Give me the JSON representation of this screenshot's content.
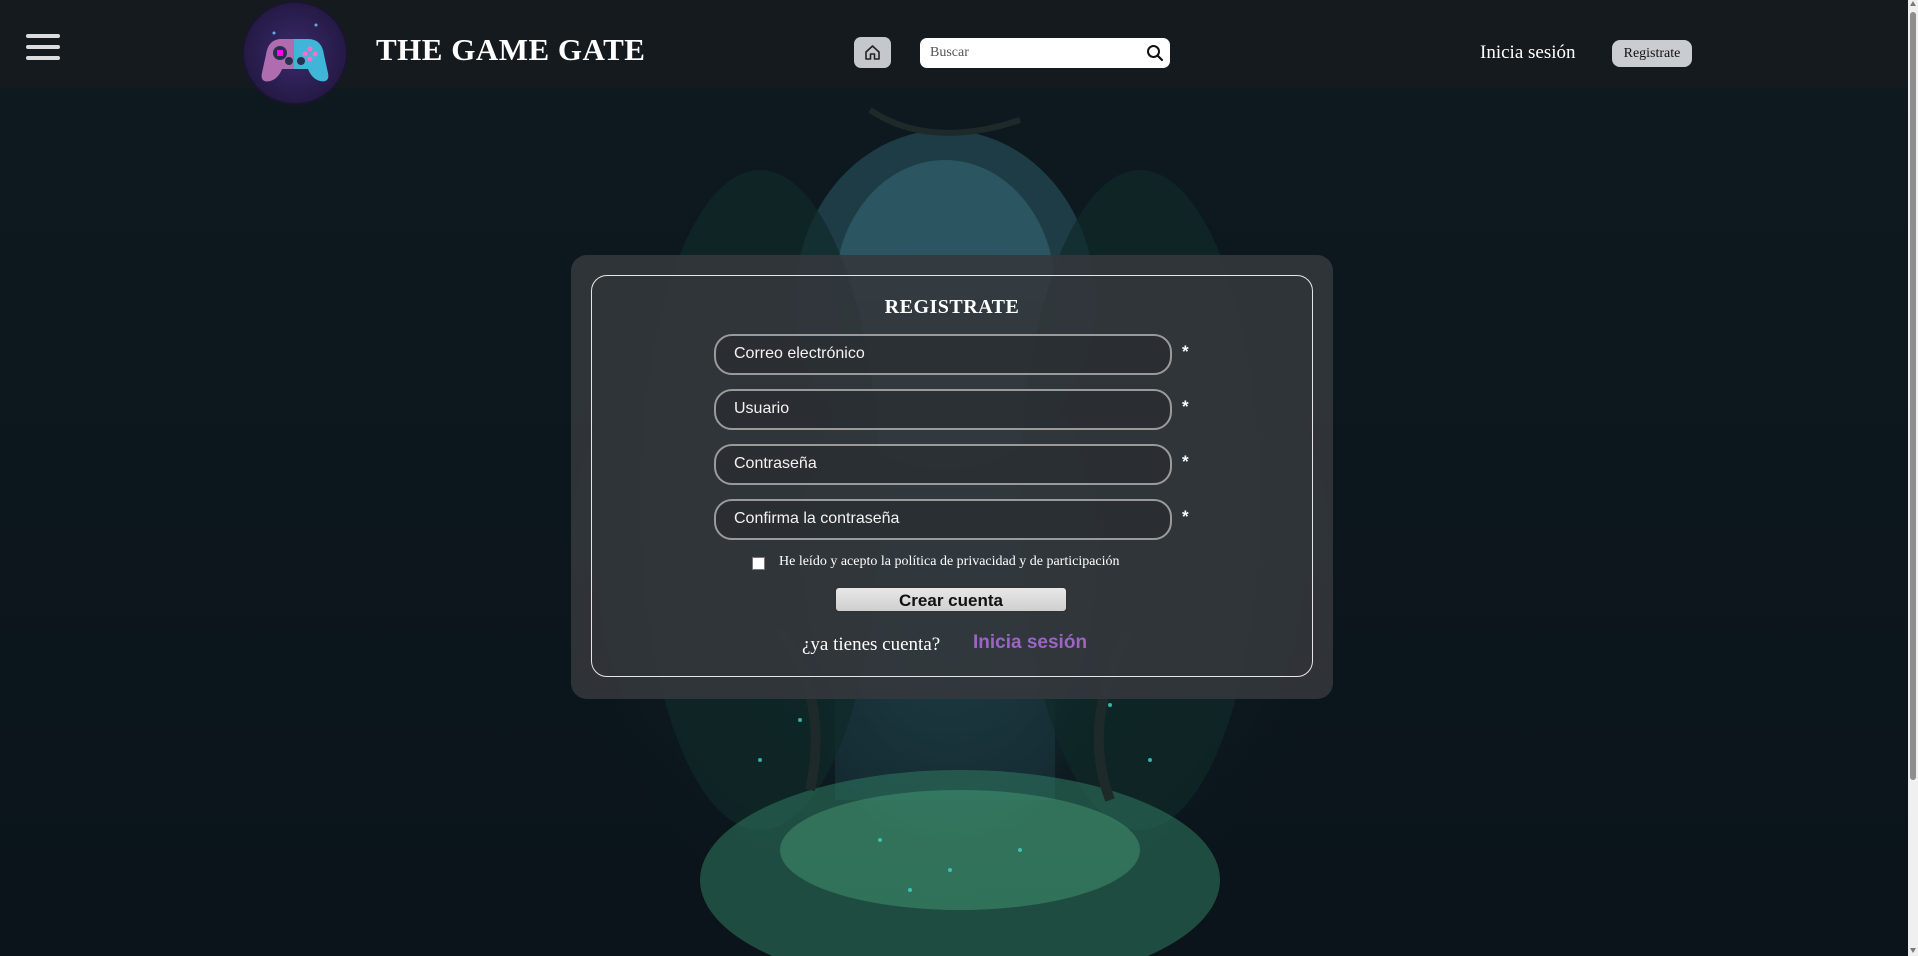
{
  "header": {
    "menu_icon": "hamburger-menu-icon",
    "logo_icon": "gamepad-logo-icon",
    "site_title": "THE GAME GATE",
    "home_icon": "home-icon",
    "search": {
      "placeholder": "Buscar",
      "icon": "search-icon"
    },
    "login_label": "Inicia sesión",
    "register_label": "Registrate"
  },
  "form": {
    "title": "REGISTRATE",
    "fields": [
      {
        "placeholder": "Correo electrónico",
        "required_mark": "*"
      },
      {
        "placeholder": "Usuario",
        "required_mark": "*"
      },
      {
        "placeholder": "Contraseña",
        "required_mark": "*"
      },
      {
        "placeholder": "Confirma la contraseña",
        "required_mark": "*"
      }
    ],
    "terms_label": "He leído y acepto la política de privacidad y de participación",
    "terms_checked": false,
    "submit_label": "Crear cuenta",
    "have_account_text": "¿ya tienes cuenta?",
    "login_link_label": "Inicia sesión"
  },
  "colors": {
    "page_background": "#0c161c",
    "header_background": "#16191d",
    "panel_background": "#34383c",
    "link_accent": "#9b64c6",
    "button_light": "#c9cdd1"
  }
}
